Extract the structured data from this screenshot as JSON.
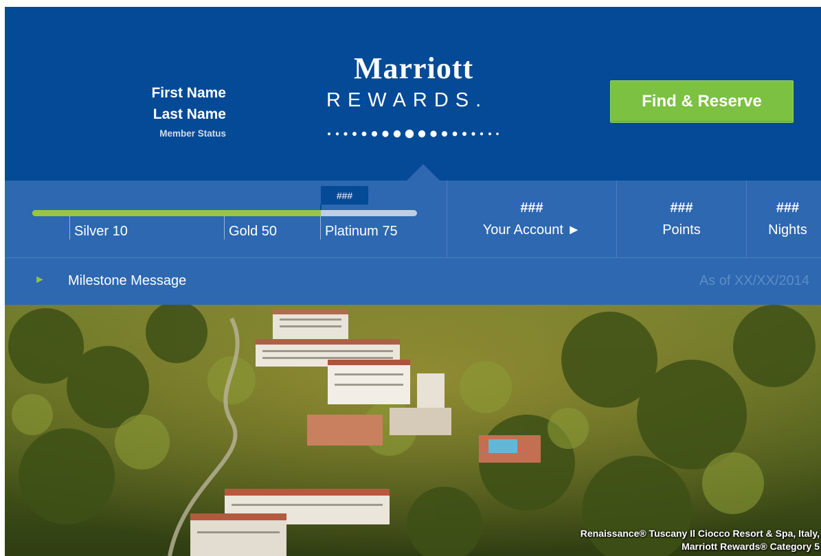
{
  "member": {
    "first_name": "First Name",
    "last_name": "Last Name",
    "status": "Member Status"
  },
  "logo": {
    "brand": "Marriott",
    "program": "REWARDS."
  },
  "cta": {
    "label": "Find & Reserve"
  },
  "progress": {
    "fill_percent": 75,
    "marker_value": "###",
    "tiers": [
      {
        "label": "Silver 10"
      },
      {
        "label": "Gold 50"
      },
      {
        "label": "Platinum 75"
      }
    ]
  },
  "stats": [
    {
      "value": "###",
      "label": "Your Account ►"
    },
    {
      "value": "###",
      "label": "Points"
    },
    {
      "value": "###",
      "label": "Nights"
    }
  ],
  "milestone": {
    "arrow": "►",
    "message": "Milestone Message",
    "as_of": "As of XX/XX/2014"
  },
  "hero": {
    "caption_line1": "Renaissance® Tuscany Il Ciocco Resort & Spa, Italy,",
    "caption_line2": "Marriott Rewards® Category 5"
  },
  "colors": {
    "header_blue": "#044a96",
    "band_blue": "#2d68b1",
    "cta_green": "#7cc142",
    "progress_green": "#9ac443"
  }
}
